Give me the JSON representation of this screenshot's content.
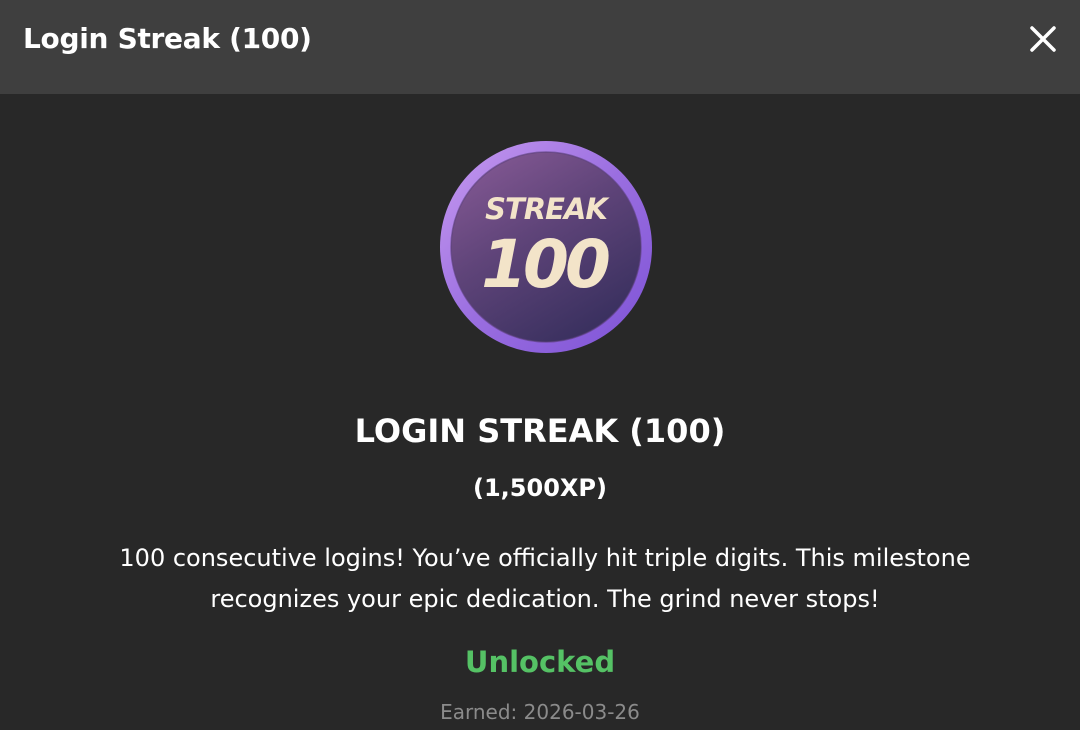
{
  "header": {
    "title": "Login Streak (100)",
    "close_icon": "close-icon"
  },
  "badge": {
    "icon": "streak-badge-icon",
    "top_text": "STREAK",
    "number_text": "100",
    "colors": {
      "ring": "#9a6ee0",
      "fill_top": "#7a4f8f",
      "fill_bottom": "#433562",
      "text": "#f3e4c9"
    }
  },
  "achievement": {
    "title": "LOGIN STREAK (100)",
    "xp": "(1,500XP)",
    "description": "100 consecutive logins! You’ve officially hit triple digits. This milestone recognizes your epic dedication. The grind never stops!",
    "status": "Unlocked",
    "earned": "Earned: 2026-03-26"
  },
  "colors": {
    "background": "#282828",
    "header_background": "#3f3f3f",
    "status_unlocked": "#55c265",
    "muted_text": "#8b8b8b"
  }
}
